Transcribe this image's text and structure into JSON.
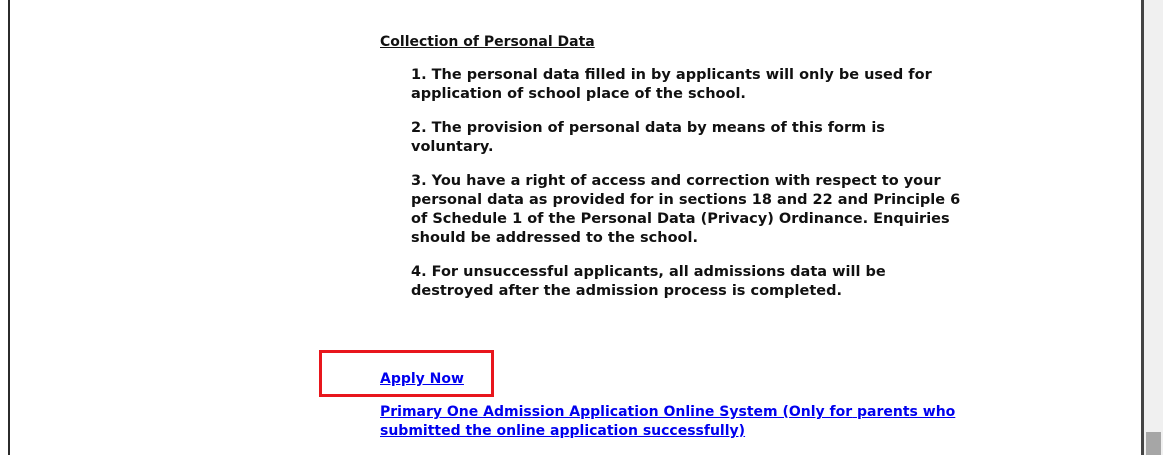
{
  "notice": {
    "heading": "Collection of Personal Data",
    "points": [
      "1. The personal data filled in by applicants will only be used for application of school place of the school.",
      "2. The provision of personal data by means of this form is voluntary.",
      "3. You have a right of access and correction with respect to your personal data as provided for in sections 18 and 22 and Principle 6 of Schedule 1 of the Personal Data (Privacy) Ordinance. Enquiries should be addressed to the school.",
      "4. For unsuccessful applicants, all admissions data will be destroyed after the admission process is completed."
    ]
  },
  "links": {
    "apply_now": "Apply Now",
    "online_system_part1": "Primary One Admission Application Online System (Only for",
    "online_system_part2": "parents who submitted the online application successfully)"
  },
  "colors": {
    "link": "#0000ee",
    "highlight": "#e8161c"
  }
}
